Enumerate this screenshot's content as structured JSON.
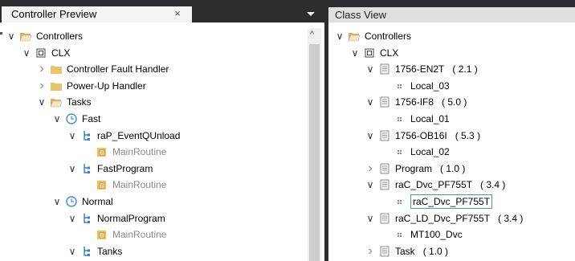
{
  "left_panel": {
    "tab_title": "Controller Preview",
    "close_glyph": "×",
    "tree": [
      {
        "label": "Controllers",
        "toggle": "expanded",
        "icon": "folder-open-icon",
        "gray": false
      },
      {
        "label": "CLX",
        "toggle": "expanded",
        "icon": "controller-icon",
        "gray": false
      },
      {
        "label": "Controller Fault Handler",
        "toggle": "collapsed",
        "icon": "folder-icon",
        "gray": false
      },
      {
        "label": "Power-Up Handler",
        "toggle": "collapsed",
        "icon": "folder-icon",
        "gray": false
      },
      {
        "label": "Tasks",
        "toggle": "expanded",
        "icon": "folder-open-icon",
        "gray": false
      },
      {
        "label": "Fast",
        "toggle": "expanded",
        "icon": "clock-icon",
        "gray": false
      },
      {
        "label": "raP_EventQUnload",
        "toggle": "expanded",
        "icon": "program-icon",
        "gray": false
      },
      {
        "label": "MainRoutine",
        "toggle": "none",
        "icon": "routine-icon",
        "gray": true
      },
      {
        "label": "FastProgram",
        "toggle": "expanded",
        "icon": "program-icon",
        "gray": false
      },
      {
        "label": "MainRoutine",
        "toggle": "none",
        "icon": "routine-icon",
        "gray": true
      },
      {
        "label": "Normal",
        "toggle": "expanded",
        "icon": "clock-icon",
        "gray": false
      },
      {
        "label": "NormalProgram",
        "toggle": "expanded",
        "icon": "program-icon",
        "gray": false
      },
      {
        "label": "MainRoutine",
        "toggle": "none",
        "icon": "routine-icon",
        "gray": true
      },
      {
        "label": "Tanks",
        "toggle": "expanded",
        "icon": "program-icon",
        "gray": false
      }
    ]
  },
  "right_panel": {
    "title": "Class View",
    "tree": [
      {
        "label": "Controllers",
        "version": "",
        "toggle": "expanded",
        "icon": "folder-open-icon",
        "selected": false
      },
      {
        "label": "CLX",
        "version": "",
        "toggle": "expanded",
        "icon": "controller-icon",
        "selected": false
      },
      {
        "label": "1756-EN2T",
        "version": "( 2.1 )",
        "toggle": "expanded",
        "icon": "class-icon",
        "selected": false
      },
      {
        "label": "Local_03",
        "version": "",
        "toggle": "none",
        "icon": "instance-icon",
        "selected": false
      },
      {
        "label": "1756-IF8",
        "version": "( 5.0 )",
        "toggle": "expanded",
        "icon": "class-icon",
        "selected": false
      },
      {
        "label": "Local_01",
        "version": "",
        "toggle": "none",
        "icon": "instance-icon",
        "selected": false
      },
      {
        "label": "1756-OB16I",
        "version": "( 5.3 )",
        "toggle": "expanded",
        "icon": "class-icon",
        "selected": false
      },
      {
        "label": "Local_02",
        "version": "",
        "toggle": "none",
        "icon": "instance-icon",
        "selected": false
      },
      {
        "label": "Program",
        "version": "( 1.0 )",
        "toggle": "collapsed",
        "icon": "class-icon",
        "selected": false
      },
      {
        "label": "raC_Dvc_PF755T",
        "version": "( 3.4 )",
        "toggle": "expanded",
        "icon": "class-icon",
        "selected": false
      },
      {
        "label": "raC_Dvc_PF755T",
        "version": "",
        "toggle": "none",
        "icon": "instance-icon",
        "selected": true
      },
      {
        "label": "raC_LD_Dvc_PF755T",
        "version": "( 3.4 )",
        "toggle": "expanded",
        "icon": "class-icon",
        "selected": false
      },
      {
        "label": "MT100_Dvc",
        "version": "",
        "toggle": "none",
        "icon": "instance-icon",
        "selected": false
      },
      {
        "label": "Task",
        "version": "( 1.0 )",
        "toggle": "collapsed",
        "icon": "class-icon",
        "selected": false
      }
    ]
  },
  "colors": {
    "chrome": "#2d2d30",
    "folder": "#e8c46a",
    "clock": "#4a90d9",
    "program": "#3a7bd5",
    "routine": "#f2c14e",
    "selection_border": "#4a90d9"
  }
}
